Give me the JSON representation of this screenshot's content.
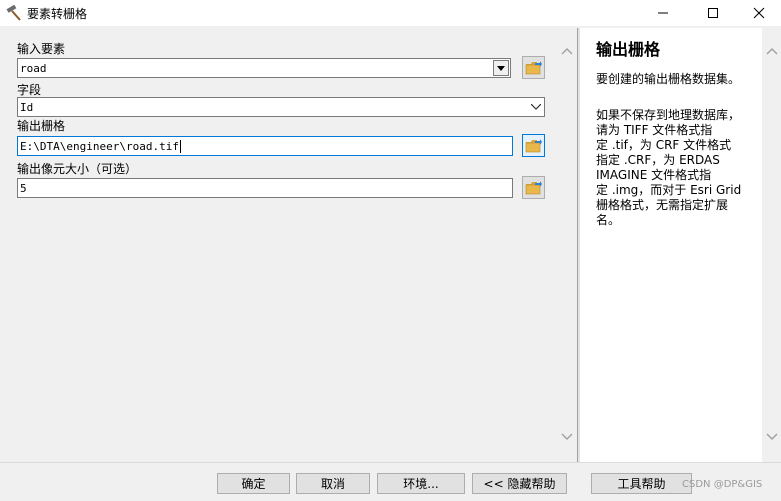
{
  "window": {
    "title": "要素转栅格",
    "minimize_icon": "minimize-icon",
    "maximize_icon": "maximize-icon",
    "close_icon": "close-icon"
  },
  "params": {
    "input_features": {
      "label": "输入要素",
      "value": "road"
    },
    "field": {
      "label": "字段",
      "value": "Id"
    },
    "output_raster": {
      "label": "输出栅格",
      "value": "E:\\DTA\\engineer\\road.tif"
    },
    "cell_size": {
      "label": "输出像元大小（可选）",
      "value": "5"
    }
  },
  "help": {
    "title": "输出栅格",
    "para1": "要创建的输出栅格数据集。",
    "lines": [
      "如果不保存到地理数据库，",
      "请为 TIFF 文件格式指",
      "定 .tif，为 CRF 文件格式",
      "指定 .CRF，为 ERDAS",
      "IMAGINE 文件格式指",
      "定 .img，而对于 Esri Grid",
      "栅格格式，无需指定扩展",
      "名。"
    ]
  },
  "buttons": {
    "ok": "确定",
    "cancel": "取消",
    "environments": "环境...",
    "hide_help": "<< 隐藏帮助",
    "tool_help": "工具帮助"
  },
  "watermark": "CSDN @DP&GIS",
  "colors": {
    "accent": "#0078d7",
    "folder": "#e8b84a"
  }
}
